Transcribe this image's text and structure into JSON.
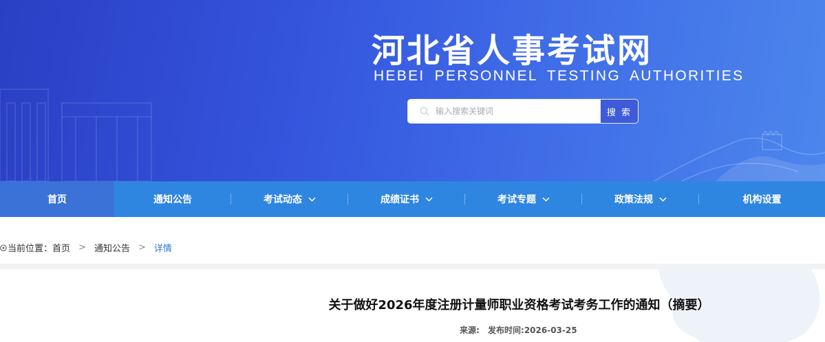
{
  "header": {
    "title": "河北省人事考试网",
    "subtitle": "HEBEI PERSONNEL TESTING AUTHORITIES"
  },
  "search": {
    "placeholder": "输入搜索关键词",
    "value": "",
    "button_label": "搜 索"
  },
  "nav": {
    "items": [
      {
        "label": "首页",
        "active": true,
        "has_dropdown": false
      },
      {
        "label": "通知公告",
        "active": false,
        "has_dropdown": false
      },
      {
        "label": "考试动态",
        "active": false,
        "has_dropdown": true
      },
      {
        "label": "成绩证书",
        "active": false,
        "has_dropdown": true
      },
      {
        "label": "考试专题",
        "active": false,
        "has_dropdown": true
      },
      {
        "label": "政策法规",
        "active": false,
        "has_dropdown": true
      },
      {
        "label": "机构设置",
        "active": false,
        "has_dropdown": false
      }
    ]
  },
  "breadcrumb": {
    "prefix": "当前位置：",
    "items": [
      "首页",
      "通知公告",
      "详情"
    ],
    "separator": ">"
  },
  "article": {
    "title": "关于做好2026年度注册计量师职业资格考试考务工作的通知（摘要）",
    "source_label": "来源:",
    "source_value": "",
    "date_label": "发布时间:",
    "date_value": "2026-03-25"
  },
  "colors": {
    "banner_start": "#2a3fc4",
    "banner_end": "#4c86ec",
    "nav_bg": "#2f86e0",
    "nav_active": "#3a72d8",
    "link_accent": "#2c7bd3"
  },
  "icons": {
    "search": "search-icon",
    "location": "location-icon",
    "dropdown": "chevron-down-icon"
  }
}
